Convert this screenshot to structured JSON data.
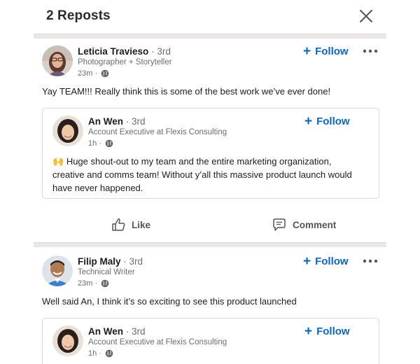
{
  "header": {
    "title": "2 Reposts"
  },
  "posts": [
    {
      "name": "Leticia Travieso",
      "degree": "· 3rd",
      "headline": "Photographer + Storyteller",
      "time": "23m ·",
      "follow_label": "Follow",
      "text": "Yay TEAM!!! Really think this is some of the best work we’ve ever done!",
      "quoted": {
        "name": "An Wen",
        "degree": "· 3rd",
        "headline": "Account Executive at Flexis Consulting",
        "time": "1h ·",
        "follow_label": "Follow",
        "emoji": "🙌",
        "text": "Huge shout-out to my team and the entire marketing organization, creative and comms team! Without y’all this massive product launch would have never happened."
      },
      "actions": {
        "like": "Like",
        "comment": "Comment"
      }
    },
    {
      "name": "Filip Maly",
      "degree": "· 3rd",
      "headline": "Technical Writer",
      "time": "23m ·",
      "follow_label": "Follow",
      "text": "Well said An, I think it’s so exciting to see this product launched",
      "quoted": {
        "name": "An Wen",
        "degree": "· 3rd",
        "headline": "Account Executive at Flexis Consulting",
        "time": "1h ·",
        "follow_label": "Follow"
      }
    }
  ],
  "colors": {
    "accent": "#0a66c2",
    "separator": "#e9e8e4"
  }
}
